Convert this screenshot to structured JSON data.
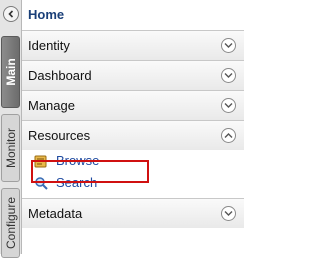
{
  "tabs": {
    "main": "Main",
    "monitor": "Monitor",
    "configure": "Configure"
  },
  "nav": {
    "home": "Home",
    "sections": {
      "identity": "Identity",
      "dashboard": "Dashboard",
      "manage": "Manage",
      "resources": "Resources",
      "metadata": "Metadata"
    },
    "resources_items": {
      "browse": "Browse",
      "search": "Search"
    }
  },
  "icons": {
    "collapse": "chevron-left-icon",
    "expand": "chevron-down-icon",
    "collapse_section": "chevron-up-icon",
    "browse": "browse-icon",
    "search": "search-icon"
  },
  "colors": {
    "home_text": "#1a3f78",
    "link_text": "#1f4aa0",
    "highlight": "#d01010"
  }
}
